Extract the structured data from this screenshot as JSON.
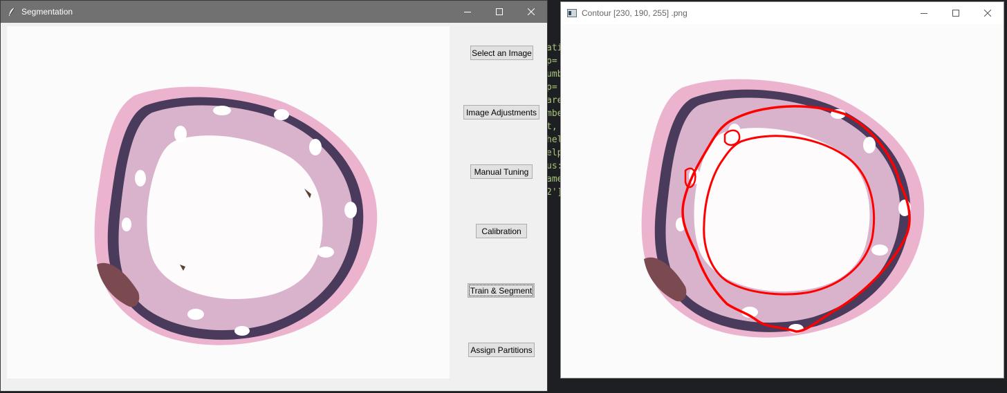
{
  "background_code": [
    "ati",
    "p=",
    "umb",
    "p=",
    "are",
    "mbe",
    "t,",
    "hel",
    "elp",
    "us:",
    "ame",
    "",
    "",
    "",
    "",
    "",
    "",
    "",
    "",
    "2']"
  ],
  "segmentation_window": {
    "title": "Segmentation",
    "buttons": [
      {
        "label": "Select an Image"
      },
      {
        "label": "Image Adjustments"
      },
      {
        "label": "Manual Tuning"
      },
      {
        "label": "Calibration"
      },
      {
        "label": "Train & Segment"
      },
      {
        "label": "Assign Partitions"
      }
    ]
  },
  "contour_window": {
    "title": "Contour [230, 190, 255] .png"
  },
  "colors": {
    "tissue_pink": "#d97aa8",
    "tissue_dark": "#4a3a5c",
    "contour_red": "#ff0000",
    "lumen": "#fdfbfc"
  }
}
